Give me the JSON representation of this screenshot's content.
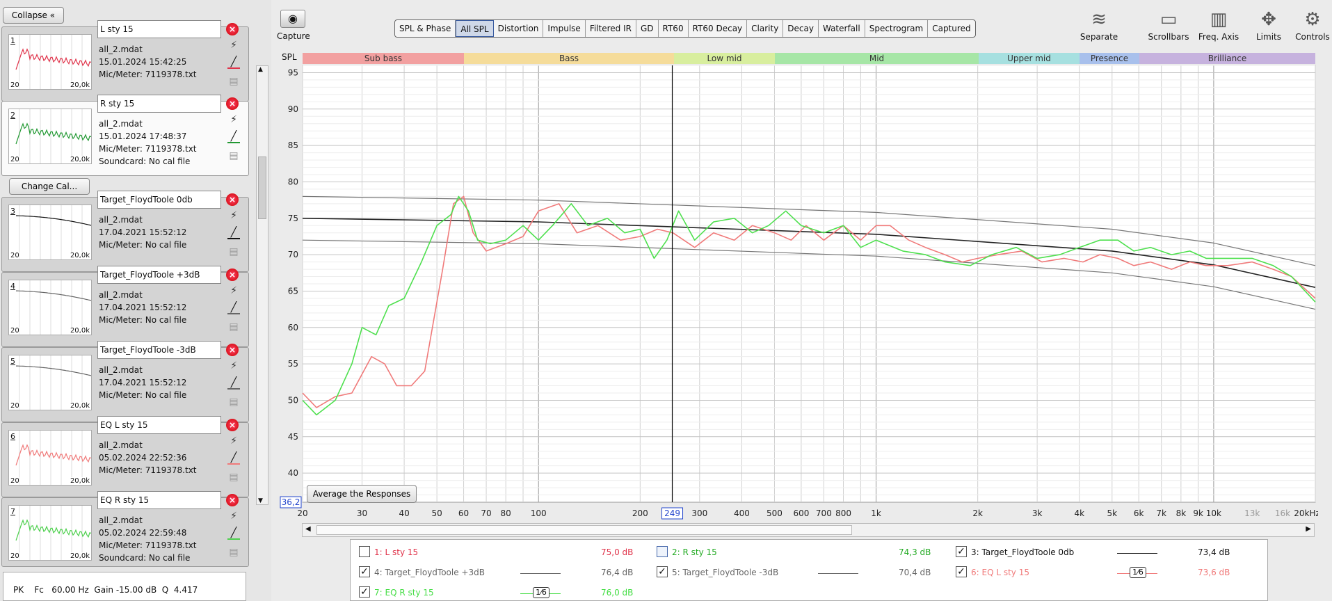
{
  "left": {
    "collapse_label": "Collapse «",
    "change_cal_label": "Change Cal...",
    "measurements": [
      {
        "num": "1",
        "name": "L sty 15",
        "file": "all_2.mdat",
        "date": "15.01.2024 15:42:25",
        "mic": "Mic/Meter: 7119378.txt",
        "sound": "",
        "color": "#e0334a",
        "axis_l": "20",
        "axis_r": "20,0k"
      },
      {
        "num": "2",
        "name": "R sty 15",
        "file": "all_2.mdat",
        "date": "15.01.2024 17:48:37",
        "mic": "Mic/Meter: 7119378.txt",
        "sound": "Soundcard: No cal file",
        "color": "#229933",
        "axis_l": "20",
        "axis_r": "20,0k"
      },
      {
        "num": "3",
        "name": "Target_FloydToole 0db",
        "file": "all_2.mdat",
        "date": "17.04.2021 15:52:12",
        "mic": "Mic/Meter: No cal file",
        "sound": "",
        "color": "#111111",
        "axis_l": "20",
        "axis_r": "20,0k"
      },
      {
        "num": "4",
        "name": "Target_FloydToole +3dB",
        "file": "all_2.mdat",
        "date": "17.04.2021 15:52:12",
        "mic": "Mic/Meter: No cal file",
        "sound": "",
        "color": "#666666",
        "axis_l": "20",
        "axis_r": "20,0k"
      },
      {
        "num": "5",
        "name": "Target_FloydToole -3dB",
        "file": "all_2.mdat",
        "date": "17.04.2021 15:52:12",
        "mic": "Mic/Meter: No cal file",
        "sound": "",
        "color": "#666666",
        "axis_l": "20",
        "axis_r": "20,0k"
      },
      {
        "num": "6",
        "name": "EQ L sty 15",
        "file": "all_2.mdat",
        "date": "05.02.2024 22:52:36",
        "mic": "Mic/Meter: 7119378.txt",
        "sound": "",
        "color": "#f07a7a",
        "axis_l": "20",
        "axis_r": "20,0k"
      },
      {
        "num": "7",
        "name": "EQ R sty 15",
        "file": "all_2.mdat",
        "date": "05.02.2024 22:59:48",
        "mic": "Mic/Meter: 7119378.txt",
        "sound": "Soundcard: No cal file",
        "color": "#4cd04c",
        "axis_l": "20",
        "axis_r": "20,0k"
      }
    ],
    "eq_line": "PK    Fc   60.00 Hz  Gain -15.00 dB  Q  4.417"
  },
  "toolbar": {
    "capture_label": "Capture",
    "tabs": [
      "SPL & Phase",
      "All SPL",
      "Distortion",
      "Impulse",
      "Filtered IR",
      "GD",
      "RT60",
      "RT60 Decay",
      "Clarity",
      "Decay",
      "Waterfall",
      "Spectrogram",
      "Captured"
    ],
    "active_tab": "All SPL",
    "right_tools": [
      "Separate",
      "Scrollbars",
      "Freq. Axis",
      "Limits",
      "Controls"
    ]
  },
  "bands": [
    {
      "label": "Sub bass",
      "color": "#f2a0a0"
    },
    {
      "label": "Bass",
      "color": "#f5dc9a"
    },
    {
      "label": "Low mid",
      "color": "#d8ee9e"
    },
    {
      "label": "Mid",
      "color": "#a6e6a6"
    },
    {
      "label": "Upper mid",
      "color": "#a6e0e0"
    },
    {
      "label": "Presence",
      "color": "#a8c0ec"
    },
    {
      "label": "Brilliance",
      "color": "#c6b2de"
    }
  ],
  "chart": {
    "y_label": "SPL",
    "y_ticks": [
      "95",
      "90",
      "85",
      "80",
      "75",
      "70",
      "65",
      "60",
      "55",
      "50",
      "45",
      "40"
    ],
    "x_ticks": [
      "20",
      "30",
      "40",
      "50",
      "60",
      "70",
      "80",
      "100",
      "200",
      "300",
      "400",
      "500",
      "600",
      "700",
      "800",
      "1k",
      "2k",
      "3k",
      "4k",
      "5k",
      "6k",
      "7k",
      "8k",
      "9k",
      "10k",
      "13k",
      "16k",
      "20kHz"
    ],
    "cursor_x": "249",
    "cursor_y": "36,2",
    "avg_button": "Average the Responses"
  },
  "chart_data": {
    "type": "line",
    "xlabel": "",
    "ylabel": "SPL",
    "xlim": [
      20,
      20000
    ],
    "ylim": [
      36,
      96
    ],
    "x_scale": "log",
    "series": [
      {
        "name": "3: Target_FloydToole 0db",
        "color": "#222222",
        "points": [
          [
            20,
            75
          ],
          [
            100,
            74.5
          ],
          [
            1000,
            72.8
          ],
          [
            5000,
            70.5
          ],
          [
            10000,
            68.6
          ],
          [
            20000,
            65.5
          ]
        ]
      },
      {
        "name": "4: Target_FloydToole +3dB",
        "color": "#777777",
        "points": [
          [
            20,
            78
          ],
          [
            100,
            77.5
          ],
          [
            1000,
            75.8
          ],
          [
            5000,
            73.5
          ],
          [
            10000,
            71.6
          ],
          [
            20000,
            68.5
          ]
        ]
      },
      {
        "name": "5: Target_FloydToole -3dB",
        "color": "#777777",
        "points": [
          [
            20,
            72
          ],
          [
            100,
            71.5
          ],
          [
            1000,
            69.8
          ],
          [
            5000,
            67.5
          ],
          [
            10000,
            65.6
          ],
          [
            20000,
            62.5
          ]
        ]
      },
      {
        "name": "6: EQ L sty 15",
        "color": "#f07a7a",
        "points": [
          [
            20,
            51
          ],
          [
            22,
            49
          ],
          [
            25,
            50.5
          ],
          [
            28,
            51
          ],
          [
            32,
            56
          ],
          [
            35,
            55
          ],
          [
            38,
            52
          ],
          [
            42,
            52
          ],
          [
            46,
            54
          ],
          [
            52,
            68
          ],
          [
            56,
            77
          ],
          [
            60,
            78
          ],
          [
            64,
            73
          ],
          [
            70,
            70.5
          ],
          [
            80,
            71.5
          ],
          [
            90,
            72.5
          ],
          [
            100,
            76
          ],
          [
            115,
            77
          ],
          [
            130,
            73
          ],
          [
            150,
            74
          ],
          [
            175,
            72
          ],
          [
            200,
            72.5
          ],
          [
            225,
            73.5
          ],
          [
            250,
            73
          ],
          [
            290,
            71
          ],
          [
            330,
            73
          ],
          [
            380,
            72
          ],
          [
            430,
            74
          ],
          [
            500,
            73
          ],
          [
            560,
            72
          ],
          [
            620,
            74
          ],
          [
            700,
            72
          ],
          [
            800,
            74
          ],
          [
            900,
            72
          ],
          [
            1000,
            74
          ],
          [
            1100,
            74
          ],
          [
            1250,
            72
          ],
          [
            1400,
            71
          ],
          [
            1600,
            70
          ],
          [
            1800,
            69
          ],
          [
            2000,
            69.5
          ],
          [
            2300,
            70
          ],
          [
            2700,
            70.5
          ],
          [
            3100,
            69
          ],
          [
            3600,
            69.5
          ],
          [
            4100,
            69
          ],
          [
            4600,
            70
          ],
          [
            5200,
            69.5
          ],
          [
            5800,
            68.5
          ],
          [
            6500,
            69
          ],
          [
            7500,
            68
          ],
          [
            8500,
            69
          ],
          [
            9500,
            68.5
          ],
          [
            11000,
            68.5
          ],
          [
            13000,
            69
          ],
          [
            15000,
            68
          ],
          [
            17000,
            67
          ],
          [
            20000,
            64
          ]
        ]
      },
      {
        "name": "7: EQ R sty 15",
        "color": "#4ee04e",
        "points": [
          [
            20,
            50
          ],
          [
            22,
            48
          ],
          [
            25,
            50
          ],
          [
            28,
            55
          ],
          [
            30,
            60
          ],
          [
            33,
            59
          ],
          [
            36,
            63
          ],
          [
            40,
            64
          ],
          [
            45,
            69
          ],
          [
            50,
            74
          ],
          [
            55,
            75.5
          ],
          [
            58,
            78
          ],
          [
            62,
            76
          ],
          [
            66,
            72
          ],
          [
            72,
            71.5
          ],
          [
            80,
            72
          ],
          [
            90,
            74
          ],
          [
            100,
            72
          ],
          [
            110,
            74
          ],
          [
            125,
            77
          ],
          [
            140,
            74
          ],
          [
            160,
            75
          ],
          [
            180,
            73
          ],
          [
            200,
            73.5
          ],
          [
            220,
            69.5
          ],
          [
            240,
            72
          ],
          [
            260,
            76
          ],
          [
            290,
            72
          ],
          [
            330,
            74.5
          ],
          [
            380,
            75
          ],
          [
            430,
            73
          ],
          [
            480,
            74
          ],
          [
            540,
            76
          ],
          [
            600,
            74
          ],
          [
            700,
            73
          ],
          [
            800,
            74
          ],
          [
            900,
            71
          ],
          [
            1000,
            72
          ],
          [
            1200,
            70.5
          ],
          [
            1400,
            70
          ],
          [
            1600,
            69
          ],
          [
            1900,
            68.5
          ],
          [
            2200,
            70
          ],
          [
            2600,
            71
          ],
          [
            3000,
            69.5
          ],
          [
            3500,
            70
          ],
          [
            4000,
            71
          ],
          [
            4600,
            72
          ],
          [
            5200,
            72
          ],
          [
            5800,
            70.5
          ],
          [
            6500,
            71
          ],
          [
            7500,
            70
          ],
          [
            8500,
            70.5
          ],
          [
            9500,
            69.5
          ],
          [
            11000,
            69.5
          ],
          [
            13000,
            69.5
          ],
          [
            15000,
            68.5
          ],
          [
            17000,
            67
          ],
          [
            20000,
            63.5
          ]
        ]
      },
      {
        "name": "1: L sty 15",
        "color": "#e0334a",
        "points": []
      },
      {
        "name": "2: R sty 15",
        "color": "#229933",
        "points": []
      }
    ]
  },
  "legend": [
    {
      "checked": false,
      "label": "1: L sty 15",
      "value": "75,0 dB",
      "color": "#e0334a",
      "smooth": ""
    },
    {
      "checked": false,
      "label": "2: R sty 15",
      "value": "74,3 dB",
      "color": "#22aa22",
      "smooth": ""
    },
    {
      "checked": true,
      "label": "3: Target_FloydToole 0db",
      "value": "73,4 dB",
      "color": "#111111",
      "smooth": ""
    },
    {
      "checked": true,
      "label": "4: Target_FloydToole +3dB",
      "value": "76,4 dB",
      "color": "#666666",
      "smooth": ""
    },
    {
      "checked": true,
      "label": "5: Target_FloydToole -3dB",
      "value": "70,4 dB",
      "color": "#666666",
      "smooth": ""
    },
    {
      "checked": true,
      "label": "6: EQ L sty 15",
      "value": "73,6 dB",
      "color": "#f07a7a",
      "smooth": "1⁄6"
    },
    {
      "checked": true,
      "label": "7: EQ R sty 15",
      "value": "76,0 dB",
      "color": "#44dd44",
      "smooth": "1⁄6"
    }
  ]
}
